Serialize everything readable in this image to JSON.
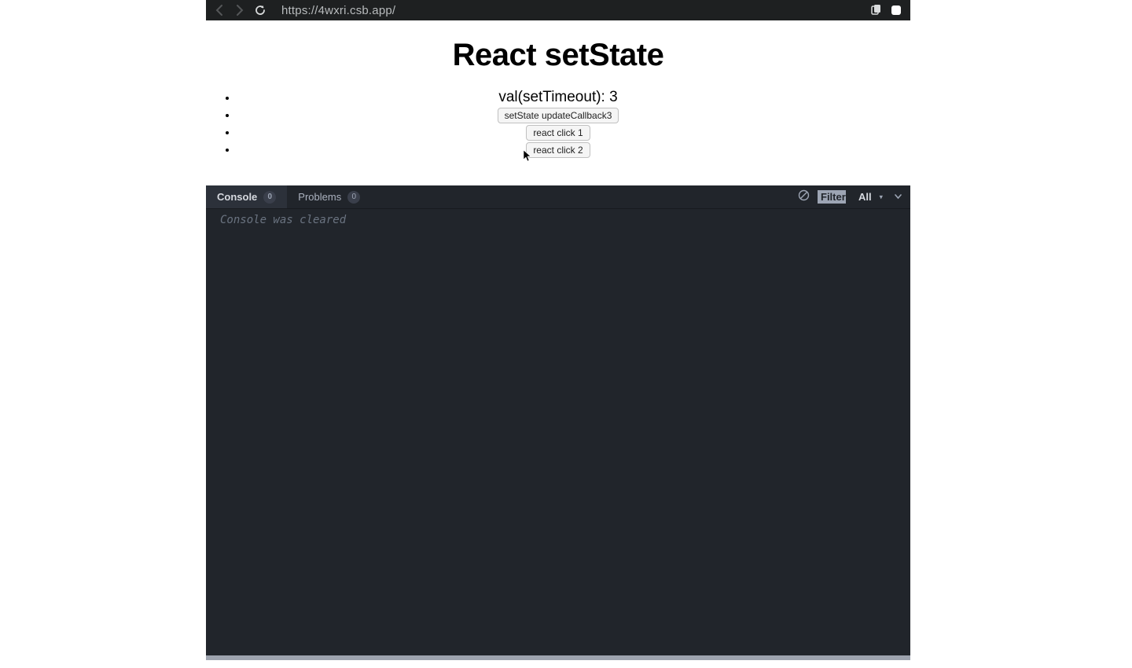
{
  "browser": {
    "url": "https://4wxri.csb.app/"
  },
  "page": {
    "title": "React setState",
    "items": [
      {
        "type": "text",
        "value": "val(setTimeout): 3"
      },
      {
        "type": "button",
        "label": "setState updateCallback3"
      },
      {
        "type": "button",
        "label": "react click 1"
      },
      {
        "type": "button",
        "label": "react click 2"
      }
    ]
  },
  "devtools": {
    "tabs": {
      "console": {
        "label": "Console",
        "count": "0"
      },
      "problems": {
        "label": "Problems",
        "count": "0"
      }
    },
    "filter_placeholder": "Filter",
    "level": "All",
    "console_message": "Console was cleared"
  }
}
